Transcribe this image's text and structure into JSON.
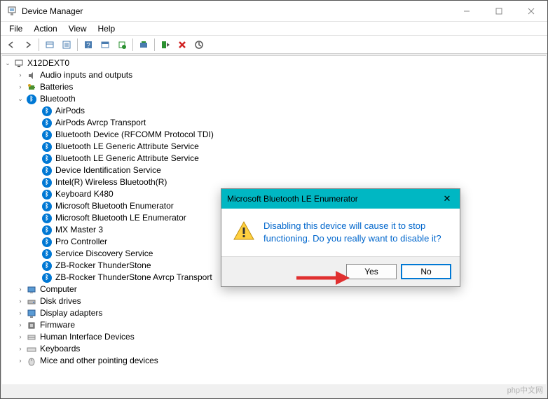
{
  "window": {
    "title": "Device Manager"
  },
  "menubar": {
    "file": "File",
    "action": "Action",
    "view": "View",
    "help": "Help"
  },
  "tree": {
    "root": "X12DEXT0",
    "audio": "Audio inputs and outputs",
    "batteries": "Batteries",
    "bluetooth": "Bluetooth",
    "bt_items": {
      "airpods": "AirPods",
      "airpods_avrcp": "AirPods Avrcp Transport",
      "bt_rfcomm": "Bluetooth Device (RFCOMM Protocol TDI)",
      "bt_le_attr1": "Bluetooth LE Generic Attribute Service",
      "bt_le_attr2": "Bluetooth LE Generic Attribute Service",
      "dev_id": "Device Identification Service",
      "intel_bt": "Intel(R) Wireless Bluetooth(R)",
      "keyboard": "Keyboard K480",
      "ms_bt_enum": "Microsoft Bluetooth Enumerator",
      "ms_bt_le_enum": "Microsoft Bluetooth LE Enumerator",
      "mx_master": "MX Master 3",
      "pro_ctrl": "Pro Controller",
      "svc_disc": "Service Discovery Service",
      "zb_rocker": "ZB-Rocker ThunderStone",
      "zb_rocker_avrcp": "ZB-Rocker ThunderStone Avrcp Transport"
    },
    "computer": "Computer",
    "disk_drives": "Disk drives",
    "display_adapters": "Display adapters",
    "firmware": "Firmware",
    "hid": "Human Interface Devices",
    "keyboards": "Keyboards",
    "mice": "Mice and other pointing devices"
  },
  "dialog": {
    "title": "Microsoft Bluetooth LE Enumerator",
    "message": "Disabling this device will cause it to stop functioning. Do you really want to disable it?",
    "yes": "Yes",
    "no": "No"
  },
  "watermark": "php中文网"
}
